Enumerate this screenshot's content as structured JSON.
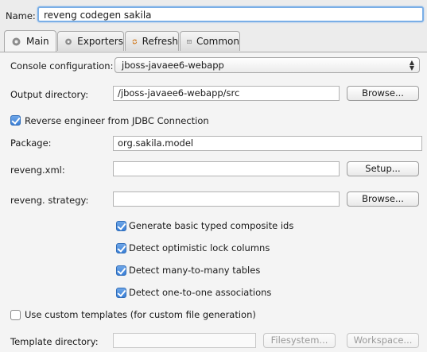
{
  "name": {
    "label": "Name:",
    "value": "reveng codegen sakila"
  },
  "tabs": [
    {
      "label": "Main",
      "icon": "hibernate-icon"
    },
    {
      "label": "Exporters",
      "icon": "hibernate-icon"
    },
    {
      "label": "Refresh",
      "icon": "refresh-icon"
    },
    {
      "label": "Common",
      "icon": "common-icon"
    }
  ],
  "main": {
    "console_config": {
      "label": "Console configuration:",
      "value": "jboss-javaee6-webapp"
    },
    "output_dir": {
      "label": "Output directory:",
      "value": "/jboss-javaee6-webapp/src",
      "button": "Browse..."
    },
    "reverse_engineer": {
      "label": "Reverse engineer from JDBC Connection",
      "checked": true
    },
    "package": {
      "label": "Package:",
      "value": "org.sakila.model"
    },
    "reveng_xml": {
      "label": "reveng.xml:",
      "value": "",
      "button": "Setup..."
    },
    "reveng_strategy": {
      "label": "reveng. strategy:",
      "value": "",
      "button": "Browse..."
    },
    "options": [
      {
        "label": "Generate basic typed composite ids",
        "checked": true
      },
      {
        "label": "Detect optimistic lock columns",
        "checked": true
      },
      {
        "label": "Detect many-to-many tables",
        "checked": true
      },
      {
        "label": "Detect one-to-one associations",
        "checked": true
      }
    ],
    "custom_templates": {
      "label": "Use custom templates (for custom file generation)",
      "checked": false
    },
    "template_dir": {
      "label": "Template directory:",
      "value": "",
      "button1": "Filesystem...",
      "button2": "Workspace..."
    }
  },
  "colors": {
    "accent": "#3a7fd6",
    "focus_border": "#7aaee6",
    "panel": "#f4f4f4"
  }
}
